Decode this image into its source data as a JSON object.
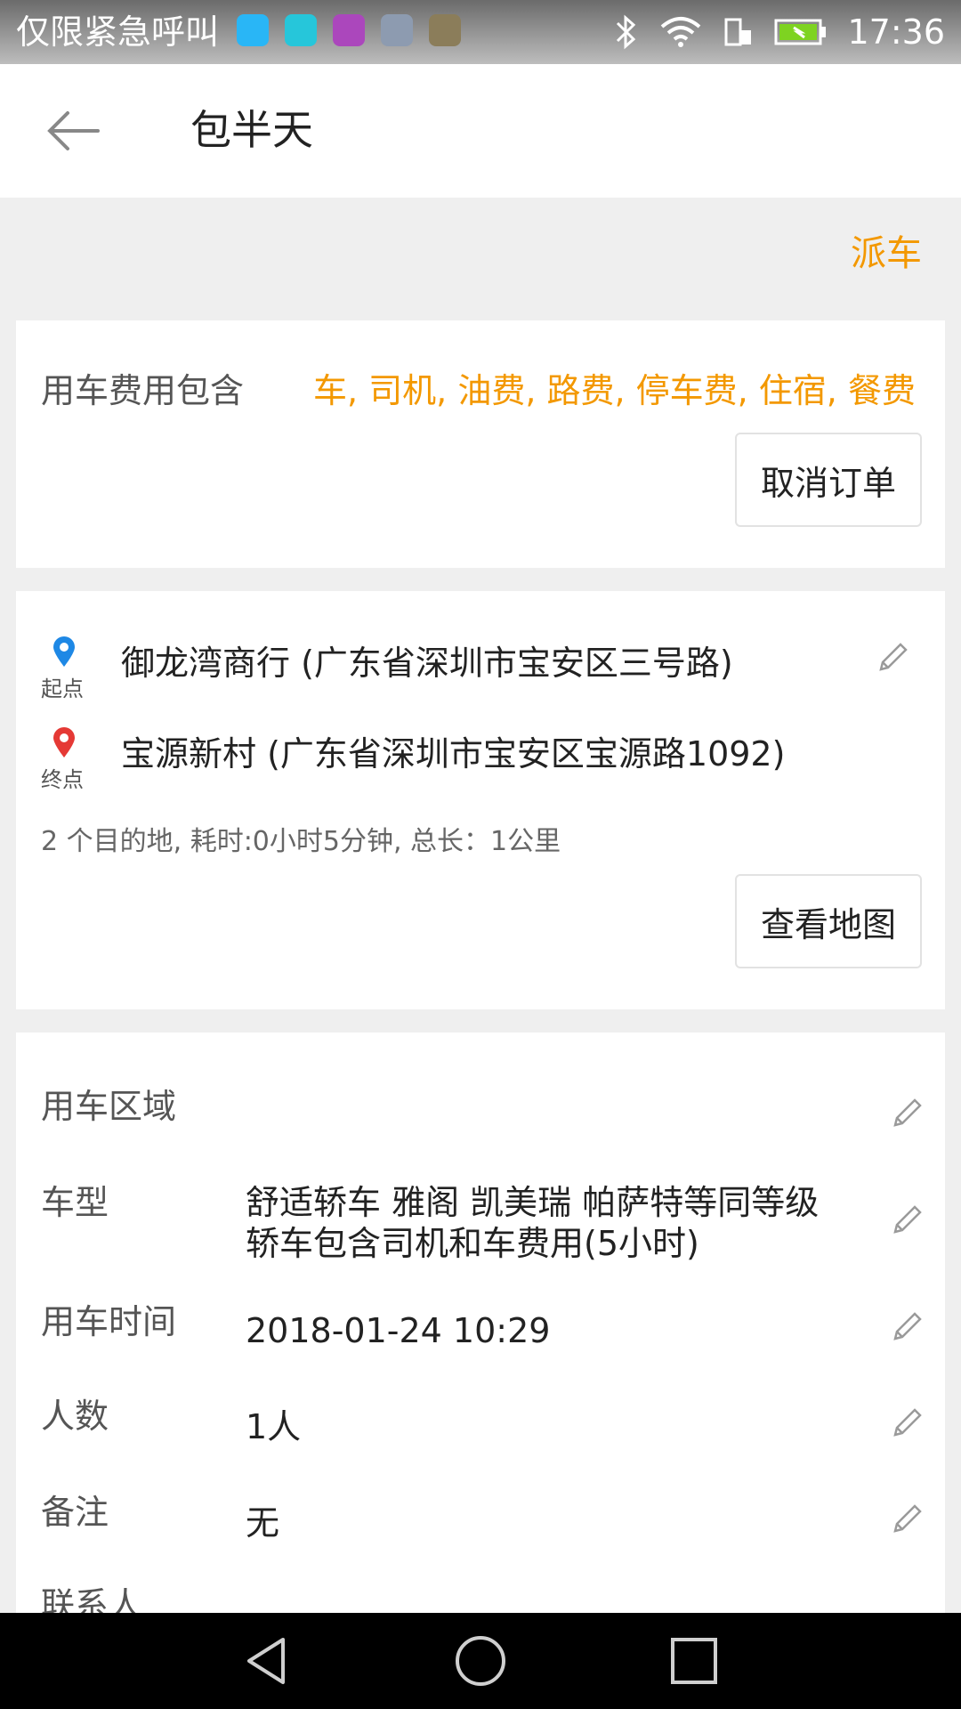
{
  "status_bar": {
    "carrier": "仅限紧急呼叫",
    "time": "17:36",
    "icons": [
      "usb-icon",
      "sim-icon",
      "keyboard-icon",
      "photo-icon",
      "video-icon",
      "bluetooth-icon",
      "wifi-icon",
      "phone-data-icon",
      "battery-icon"
    ]
  },
  "header": {
    "title": "包半天"
  },
  "actions": {
    "dispatch": "派车"
  },
  "fee": {
    "label": "用车费用包含",
    "value": "车, 司机, 油费, 路费, 停车费, 住宿, 餐费",
    "cancel_button": "取消订单"
  },
  "route": {
    "start": {
      "caption": "起点",
      "text": "御龙湾商行 (广东省深圳市宝安区三号路)"
    },
    "end": {
      "caption": "终点",
      "text": "宝源新村 (广东省深圳市宝安区宝源路1092)"
    },
    "summary": "2 个目的地, 耗时:0小时5分钟, 总长：1公里",
    "map_button": "查看地图"
  },
  "details": {
    "area_label": "用车区域",
    "car_type_label": "车型",
    "car_type_value_line1": "舒适轿车 雅阁 凯美瑞 帕萨特等同等级",
    "car_type_value_line2": "轿车包含司机和车费用(5小时)",
    "time_label": "用车时间",
    "time_value": "2018-01-24 10:29",
    "people_label": "人数",
    "people_value": "1人",
    "note_label": "备注",
    "note_value": "无",
    "contact_label": "联系人"
  },
  "colors": {
    "accent": "#f39800",
    "start_pin": "#1e88e5",
    "end_pin": "#e53935"
  }
}
